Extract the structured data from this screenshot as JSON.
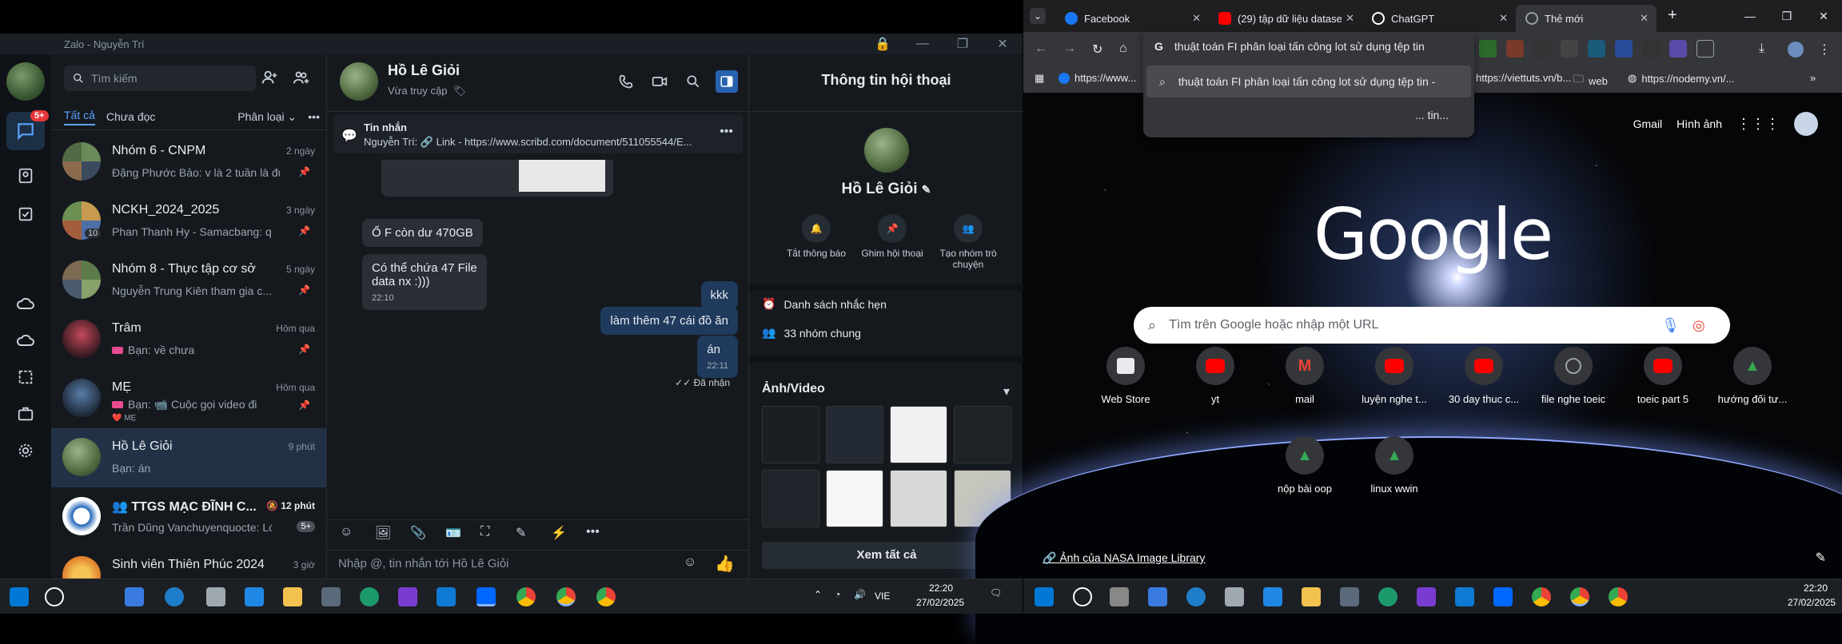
{
  "zalo": {
    "window_title": "Zalo - Nguyễn Trí",
    "badge": "5+",
    "search_placeholder": "Tìm kiếm",
    "filter": {
      "all": "Tất cả",
      "unread": "Chưa đọc",
      "classify": "Phân loại"
    },
    "conversations": [
      {
        "name": "Nhóm 6 - CNPM",
        "time": "2 ngày",
        "preview": "Đặng Phước Bảo: v là 2 tuần là đủ á"
      },
      {
        "name": "NCKH_2024_2025",
        "time": "3 ngày",
        "preview": "Phan Thanh Hy - Samacbang: qua ..."
      },
      {
        "name": "Nhóm 8 - Thực tập cơ sở",
        "time": "5 ngày",
        "preview": "Nguyễn Trung Kiên tham gia c..."
      },
      {
        "name": "Trâm",
        "time": "Hôm qua",
        "preview": "Bạn: về chưa"
      },
      {
        "name": "MẸ",
        "time": "Hôm qua",
        "preview": "Bạn: 📹 Cuộc gọi video đi"
      },
      {
        "name": "Hồ Lê Giỏi",
        "time": "9 phút",
        "preview": "Bạn: án"
      },
      {
        "name": "TTGS MẠC ĐĨNH C...",
        "time": "12 phút",
        "preview": "Trần Dũng Vanchuyenquocte: Lớp ..."
      },
      {
        "name": "Sinh viên Thiên Phúc 2024_2...",
        "time": "3 giờ",
        "preview": ""
      }
    ],
    "extra": {
      "me_reaction": "MẸ",
      "count_10": "10",
      "five_plus": "5+"
    },
    "chat": {
      "name": "Hồ Lê Giỏi",
      "status": "Vừa truy cập",
      "pinned_title": "Tin nhắn",
      "pinned_text": "Nguyễn Trí: 🔗 Link - https://www.scribd.com/document/511055544/E...",
      "messages": [
        {
          "text": "Ổ F còn dư 470GB",
          "time": ""
        },
        {
          "text": "Có thể chứa 47 File data nx :)))",
          "time": "22:10"
        },
        {
          "text": "kkk",
          "time": ""
        },
        {
          "text": "làm thêm 47 cái đồ ăn",
          "time": ""
        },
        {
          "text": "án",
          "time": "22:11"
        }
      ],
      "received": "Đã nhận",
      "input_placeholder": "Nhập @, tin nhắn tới Hồ Lê Giỏi"
    },
    "info": {
      "title": "Thông tin hội thoại",
      "name": "Hồ Lê Giỏi",
      "actions": [
        "Tắt thông báo",
        "Ghim hội thoại",
        "Tạo nhóm trò chuyện"
      ],
      "reminders": "Danh sách nhắc hẹn",
      "groups": "33 nhóm chung",
      "media_title": "Ảnh/Video",
      "see_all": "Xem tất cả"
    }
  },
  "chrome": {
    "tabs": [
      {
        "label": "Facebook",
        "color": "#1877f2"
      },
      {
        "label": "(29) tập dữ liệu datase",
        "color": "#ff0000"
      },
      {
        "label": "ChatGPT",
        "color": "#ffffff"
      },
      {
        "label": "Thẻ mới",
        "color": "#9aa0a6"
      }
    ],
    "omnibox_text": "thuật toán FI phân loại tấn công lot sử dụng tệp tin",
    "suggestion": "thuật toán FI phân loại tấn công lot sử dụng tệp tin -",
    "suggestion_more": "... tin...",
    "bookmarks": [
      "https://www...",
      "https://viettuts.vn/b...",
      "web",
      "https://nodemy.vn/..."
    ],
    "gmail": "Gmail",
    "images": "Hình ảnh",
    "logo": "Google",
    "search_placeholder": "Tìm trên Google hoặc nhập một URL",
    "shortcuts": [
      {
        "label": "Web Store",
        "color": "#e8eaed"
      },
      {
        "label": "yt",
        "color": "#ff0000"
      },
      {
        "label": "mail",
        "color": "#ea4335"
      },
      {
        "label": "luyện nghe t...",
        "color": "#ff0000"
      },
      {
        "label": "30 day thuc c...",
        "color": "#ff0000"
      },
      {
        "label": "file nghe toeic",
        "color": "#9aa0a6"
      },
      {
        "label": "toeic part 5",
        "color": "#ff0000"
      },
      {
        "label": "hướng đối tư...",
        "color": "#34a853"
      },
      {
        "label": "nộp bài oop",
        "color": "#34a853"
      },
      {
        "label": "linux wwin",
        "color": "#34a853"
      }
    ],
    "nasa": "Ảnh của NASA Image Library"
  },
  "taskbar_left": {
    "lang": "VIE",
    "time": "22:20",
    "date": "27/02/2025"
  },
  "taskbar_right": {
    "time": "22:20",
    "date": "27/02/2025"
  }
}
